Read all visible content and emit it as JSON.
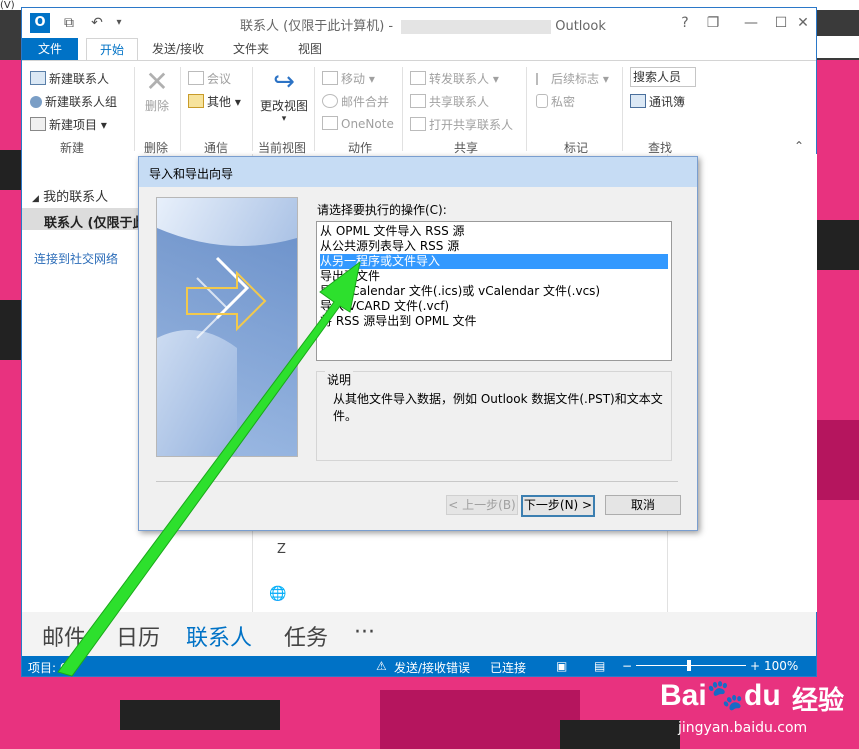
{
  "window": {
    "title_prefix": "联系人 (仅限于此计算机) - ",
    "title_suffix": "Outlook",
    "help": "?",
    "restore": "❐",
    "minimize": "—",
    "close": "✕",
    "app_icon_text": "O",
    "menu_fragment": "(V)"
  },
  "tabs": [
    "文件",
    "开始",
    "发送/接收",
    "文件夹",
    "视图"
  ],
  "ribbon": {
    "new_contact": "新建联系人",
    "new_group": "新建联系人组",
    "new_items": "新建项目",
    "group_new": "新建",
    "delete": "删除",
    "group_delete": "删除",
    "meeting": "会议",
    "more": "其他",
    "group_comm": "通信",
    "change_view": "更改视图",
    "group_view": "当前视图",
    "move": "移动",
    "mail_merge": "邮件合并",
    "onenote": "OneNote",
    "group_actions": "动作",
    "forward_contact": "转发联系人",
    "share_contacts": "共享联系人",
    "open_shared": "打开共享联系人",
    "group_share": "共享",
    "follow_up": "后续标志",
    "private": "私密",
    "group_tags": "标记",
    "search_people": "搜索人员",
    "address_book": "通讯簿",
    "group_find": "查找",
    "collapse": "⌃"
  },
  "leftpane": {
    "my_contacts": "我的联系人",
    "contacts_folder": "联系人 (仅限于此",
    "connect_social": "连接到社交网络"
  },
  "center": {
    "letter_z": "Z"
  },
  "navbar": [
    "邮件",
    "日历",
    "联系人",
    "任务",
    "···"
  ],
  "status": {
    "items": "项目: 0",
    "send_error": "发送/接收错误",
    "connected": "已连接",
    "zoom": "100%"
  },
  "dialog": {
    "title": "导入和导出向导",
    "prompt": "请选择要执行的操作(C):",
    "options": [
      "从 OPML 文件导入 RSS 源",
      "从公共源列表导入 RSS 源",
      "从另一程序或文件导入",
      "导出到文件",
      "导入 iCalendar 文件(.ics)或 vCalendar 文件(.vcs)",
      "导入 VCARD 文件(.vcf)",
      "将 RSS 源导出到 OPML 文件"
    ],
    "selected_index": 2,
    "desc_title": "说明",
    "desc_text": "从其他文件导入数据，例如 Outlook 数据文件(.PST)和文本文件。",
    "back": "< 上一步(B)",
    "next": "下一步(N) >",
    "cancel": "取消"
  },
  "watermark": {
    "brand": "Bai",
    "brand2": "du",
    "site": "经验",
    "url": "jingyan.baidu.com"
  },
  "colors": {
    "accent": "#0072c6",
    "selection": "#3399ff",
    "arrow": "#22dd22",
    "background_pink": "#e8327f"
  }
}
